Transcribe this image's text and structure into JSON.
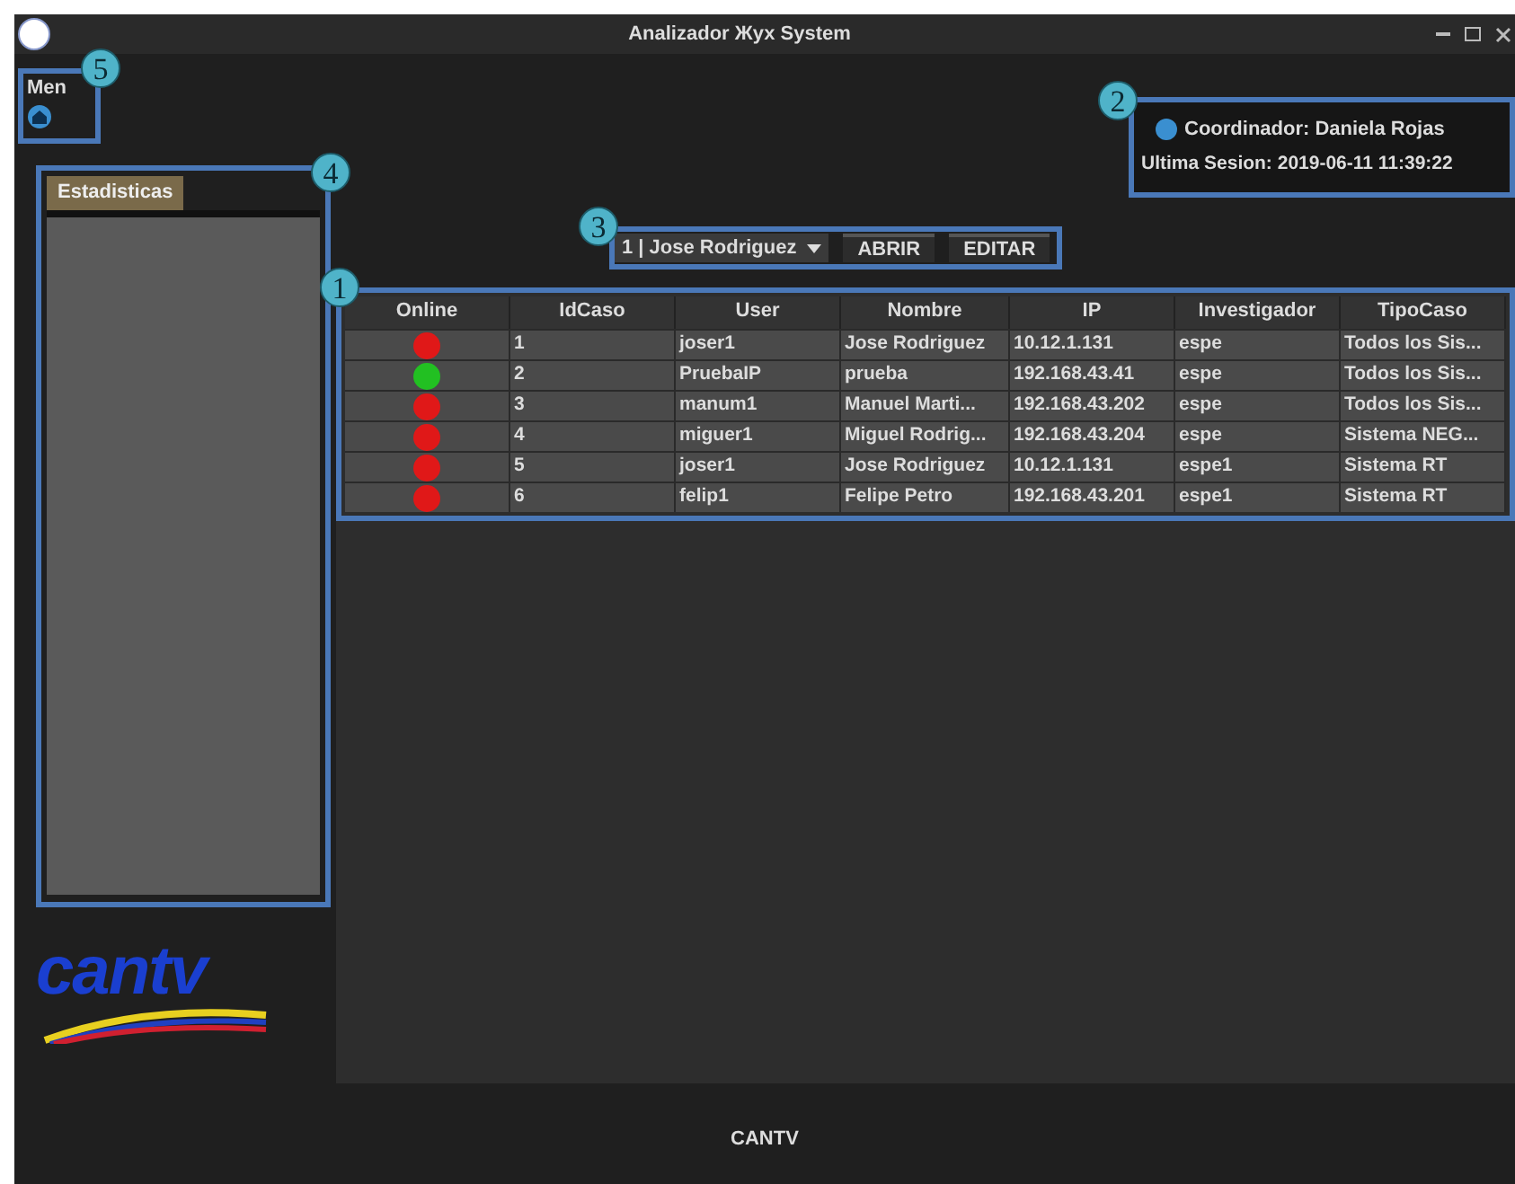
{
  "window": {
    "title": "Analizador Жух System"
  },
  "menu": {
    "label": "Men",
    "callout": "5"
  },
  "sidebar": {
    "tab": "Estadisticas",
    "callout": "4"
  },
  "session": {
    "coordinator": "Coordinador: Daniela Rojas",
    "last_session": "Ultima Sesion: 2019-06-11 11:39:22",
    "callout": "2"
  },
  "toolbar": {
    "case_select": "1 | Jose Rodriguez",
    "buttons": [
      "ABRIR",
      "EDITAR"
    ],
    "callout": "3"
  },
  "table": {
    "callout": "1",
    "columns": [
      "Online",
      "IdCaso",
      "User",
      "Nombre",
      "IP",
      "Investigador",
      "TipoCaso"
    ],
    "rows": [
      {
        "online": false,
        "cells": [
          "",
          "1",
          "joser1",
          "Jose Rodriguez",
          "10.12.1.131",
          "espe",
          "Todos los Sis..."
        ]
      },
      {
        "online": true,
        "cells": [
          "",
          "2",
          "PruebaIP",
          "prueba",
          "192.168.43.41",
          "espe",
          "Todos los Sis..."
        ]
      },
      {
        "online": false,
        "cells": [
          "",
          "3",
          "manum1",
          "Manuel Marti...",
          "192.168.43.202",
          "espe",
          "Todos los Sis..."
        ]
      },
      {
        "online": false,
        "cells": [
          "",
          "4",
          "miguer1",
          "Miguel Rodrig...",
          "192.168.43.204",
          "espe",
          "Sistema NEG..."
        ]
      },
      {
        "online": false,
        "cells": [
          "",
          "5",
          "joser1",
          "Jose Rodriguez",
          "10.12.1.131",
          "espe1",
          "Sistema RT"
        ]
      },
      {
        "online": false,
        "cells": [
          "",
          "6",
          "felip1",
          "Felipe Petro",
          "192.168.43.201",
          "espe1",
          "Sistema RT"
        ]
      }
    ]
  },
  "logo": {
    "text": "cantv"
  },
  "status_bar": {
    "text": "CANTV"
  }
}
